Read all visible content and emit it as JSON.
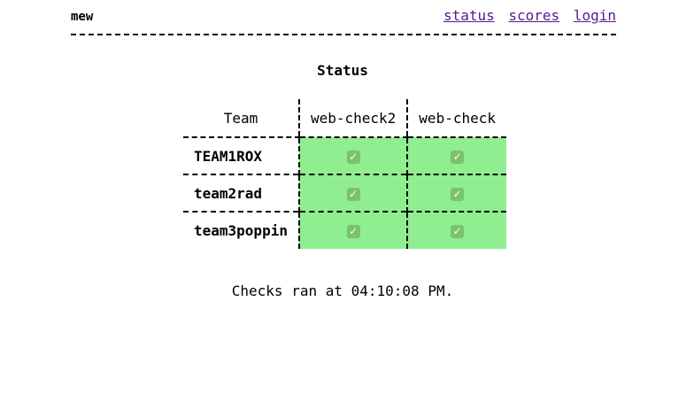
{
  "header": {
    "brand": "mew",
    "nav": [
      {
        "label": "status"
      },
      {
        "label": "scores"
      },
      {
        "label": "login"
      }
    ]
  },
  "page_title": "Status",
  "table": {
    "team_header": "Team",
    "columns": [
      "web-check2",
      "web-check"
    ],
    "rows": [
      {
        "team": "TEAM1ROX",
        "cells": [
          "✓",
          "✓"
        ]
      },
      {
        "team": "team2rad",
        "cells": [
          "✓",
          "✓"
        ]
      },
      {
        "team": "team3poppin",
        "cells": [
          "✓",
          "✓"
        ]
      }
    ],
    "ok_color": "#90ee90",
    "check_icon": "checkbox-checked-icon"
  },
  "footer": {
    "checks_time": "Checks ran at 04:10:08 PM."
  }
}
